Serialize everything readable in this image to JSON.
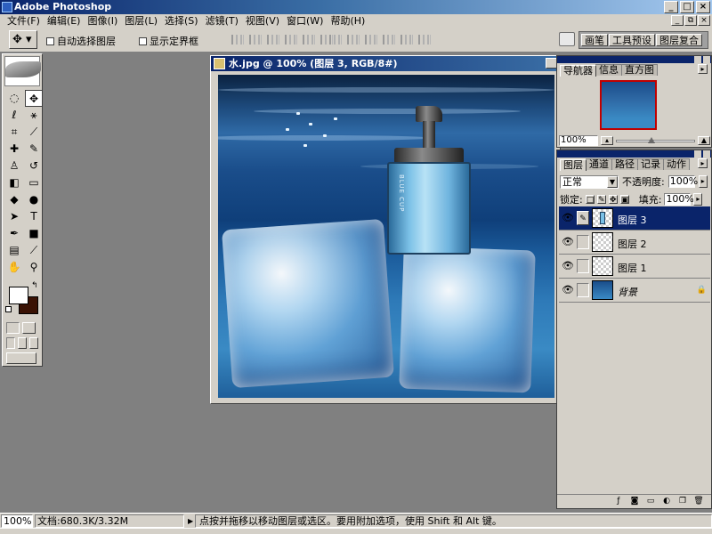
{
  "app": {
    "title": "Adobe Photoshop"
  },
  "window_buttons": [
    "_",
    "□",
    "×"
  ],
  "mdi_buttons": [
    "_",
    "⧉",
    "×"
  ],
  "menu": [
    "文件(F)",
    "编辑(E)",
    "图像(I)",
    "图层(L)",
    "选择(S)",
    "滤镜(T)",
    "视图(V)",
    "窗口(W)",
    "帮助(H)"
  ],
  "options": {
    "tool_icon": "move-tool-icon",
    "auto_select_label": "自动选择图层",
    "show_bounds_label": "显示定界框",
    "palette_well_tabs": [
      "画笔",
      "工具预设",
      "图层复合"
    ]
  },
  "toolbox": {
    "tools": [
      {
        "name": "marquee-tool-icon",
        "glyph": "◌"
      },
      {
        "name": "move-tool-icon",
        "glyph": "✥"
      },
      {
        "name": "lasso-tool-icon",
        "glyph": "ℓ"
      },
      {
        "name": "magic-wand-tool-icon",
        "glyph": "⚹"
      },
      {
        "name": "crop-tool-icon",
        "glyph": "⌗"
      },
      {
        "name": "slice-tool-icon",
        "glyph": "⟋"
      },
      {
        "name": "healing-brush-tool-icon",
        "glyph": "✚"
      },
      {
        "name": "brush-tool-icon",
        "glyph": "✎"
      },
      {
        "name": "clone-stamp-tool-icon",
        "glyph": "♙"
      },
      {
        "name": "history-brush-tool-icon",
        "glyph": "↺"
      },
      {
        "name": "eraser-tool-icon",
        "glyph": "◧"
      },
      {
        "name": "gradient-tool-icon",
        "glyph": "▭"
      },
      {
        "name": "blur-tool-icon",
        "glyph": "◆"
      },
      {
        "name": "dodge-tool-icon",
        "glyph": "●"
      },
      {
        "name": "path-selection-tool-icon",
        "glyph": "➤"
      },
      {
        "name": "type-tool-icon",
        "glyph": "T"
      },
      {
        "name": "pen-tool-icon",
        "glyph": "✒"
      },
      {
        "name": "shape-tool-icon",
        "glyph": "■"
      },
      {
        "name": "notes-tool-icon",
        "glyph": "▤"
      },
      {
        "name": "eyedropper-tool-icon",
        "glyph": "⟋"
      },
      {
        "name": "hand-tool-icon",
        "glyph": "✋"
      },
      {
        "name": "zoom-tool-icon",
        "glyph": "⚲"
      }
    ]
  },
  "document": {
    "title": "水.jpg @ 100% (图层 3, RGB/8#)",
    "bottle_text": "BLUE CUP"
  },
  "navigator": {
    "tabs": [
      "导航器",
      "信息",
      "直方图"
    ],
    "zoom": "100%"
  },
  "layers_panel": {
    "tabs": [
      "图层",
      "通道",
      "路径",
      "记录",
      "动作"
    ],
    "blend_mode": "正常",
    "opacity_label": "不透明度:",
    "opacity_value": "100%",
    "lock_label": "锁定:",
    "fill_label": "填充:",
    "fill_value": "100%",
    "layers": [
      {
        "name": "图层 3",
        "selected": true
      },
      {
        "name": "图层 2",
        "selected": false
      },
      {
        "name": "图层 1",
        "selected": false
      },
      {
        "name": "背景",
        "selected": false,
        "background": true
      }
    ]
  },
  "status": {
    "zoom": "100%",
    "doc_info": "文档:680.3K/3.32M",
    "hint": "点按并拖移以移动图层或选区。要用附加选项，使用 Shift 和 Alt 键。"
  },
  "colors": {
    "title_bar": "#0a246a",
    "face": "#d4d0c8",
    "workspace": "#808080",
    "foreground": "#ffffff",
    "background": "#3a1204",
    "selected_layer": "#0a246a"
  }
}
